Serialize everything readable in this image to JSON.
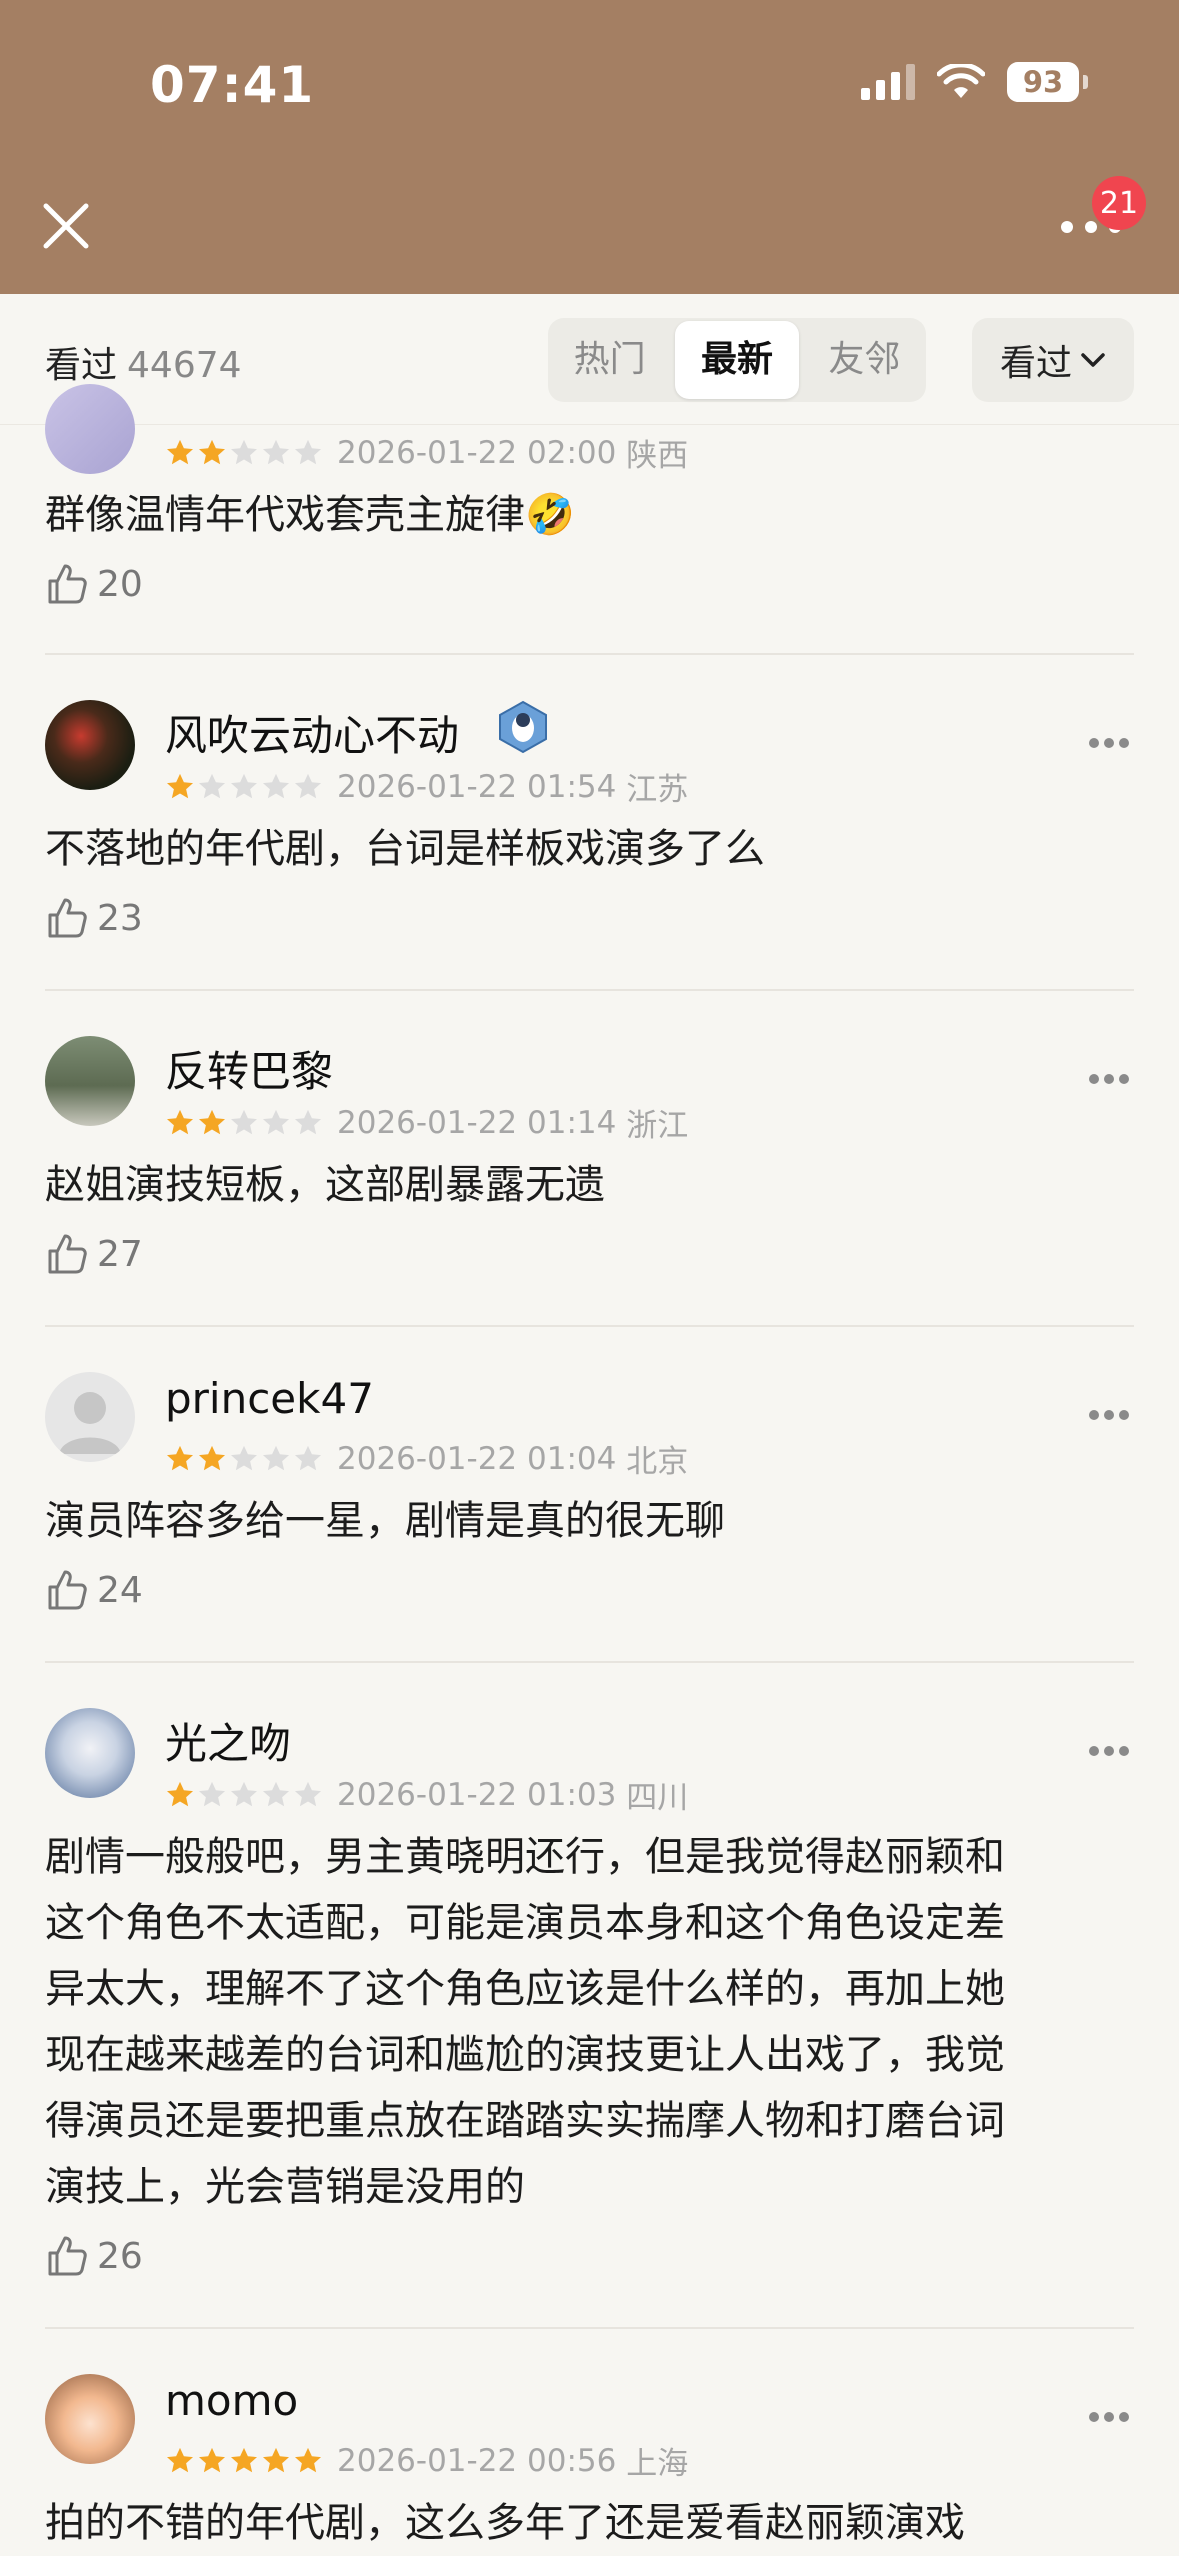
{
  "status_bar": {
    "time": "07:41",
    "battery": "93"
  },
  "header": {
    "notification_count": "21"
  },
  "filter": {
    "seen_label": "看过",
    "seen_count": "44674",
    "tabs": [
      {
        "label": "热门",
        "active": false
      },
      {
        "label": "最新",
        "active": true
      },
      {
        "label": "友邻",
        "active": false
      }
    ],
    "dropdown_label": "看过"
  },
  "reviews": [
    {
      "username": "",
      "rating": 2,
      "datetime": "2026-01-22 02:00",
      "location": "陕西",
      "text": "群像温情年代戏套壳主旋律🤣",
      "likes": "20"
    },
    {
      "username": "风吹云动心不动",
      "rating": 1,
      "datetime": "2026-01-22 01:54",
      "location": "江苏",
      "text": "不落地的年代剧，台词是样板戏演多了么",
      "likes": "23"
    },
    {
      "username": "反转巴黎",
      "rating": 2,
      "datetime": "2026-01-22 01:14",
      "location": "浙江",
      "text": "赵姐演技短板，这部剧暴露无遗",
      "likes": "27"
    },
    {
      "username": "princek47",
      "rating": 2,
      "datetime": "2026-01-22 01:04",
      "location": "北京",
      "text": "演员阵容多给一星，剧情是真的很无聊",
      "likes": "24"
    },
    {
      "username": "光之吻",
      "rating": 1,
      "datetime": "2026-01-22 01:03",
      "location": "四川",
      "text_lines": [
        "剧情一般般吧，男主黄晓明还行，但是我觉得赵丽颖和",
        "这个角色不太适配，可能是演员本身和这个角色设定差",
        "异太大，理解不了这个角色应该是什么样的，再加上她",
        "现在越来越差的台词和尴尬的演技更让人出戏了，我觉",
        "得演员还是要把重点放在踏踏实实揣摩人物和打磨台词",
        "演技上，光会营销是没用的"
      ],
      "likes": "26"
    },
    {
      "username": "momo",
      "rating": 5,
      "datetime": "2026-01-22 00:56",
      "location": "上海",
      "text": "拍的不错的年代剧，这么多年了还是爱看赵丽颖演戏"
    }
  ],
  "colors": {
    "header_bg": "#a47f63",
    "star_on": "#f5a623",
    "star_off": "#dcdcdc",
    "badge": "#f0454f"
  }
}
